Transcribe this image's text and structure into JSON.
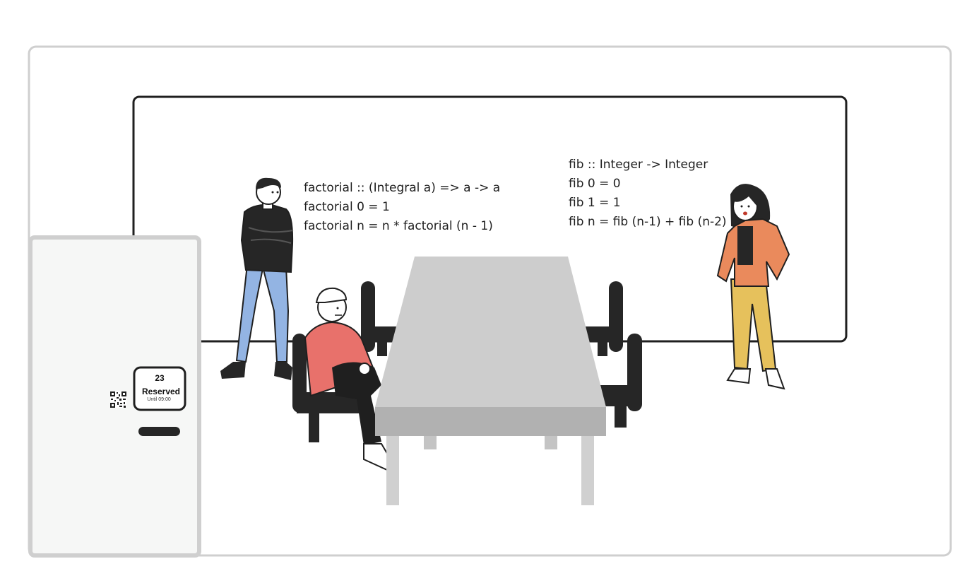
{
  "whiteboard": {
    "factorial_code": [
      "factorial :: (Integral a) => a -> a",
      "factorial 0 = 1",
      "factorial n = n * factorial (n - 1)"
    ],
    "fib_code": [
      "fib :: Integer -> Integer",
      "fib 0 = 0",
      "fib 1 = 1",
      "fib n = fib (n-1) + fib (n-2)"
    ]
  },
  "room_sign": {
    "number": "23",
    "status": "Reserved",
    "detail": "Until 09:00"
  },
  "colors": {
    "frame": "#cfcfcf",
    "whiteboard_border": "#1f1f1f",
    "table_top": "#cdcdcd",
    "table_front": "#b1b1b1",
    "chair": "#262626",
    "door": "#f6f7f6",
    "person_red_shirt": "#e8716b",
    "person_blue_jeans": "#93b4e3",
    "person_orange_jacket": "#ea8a5c",
    "person_yellow_pants": "#e6c15c"
  }
}
